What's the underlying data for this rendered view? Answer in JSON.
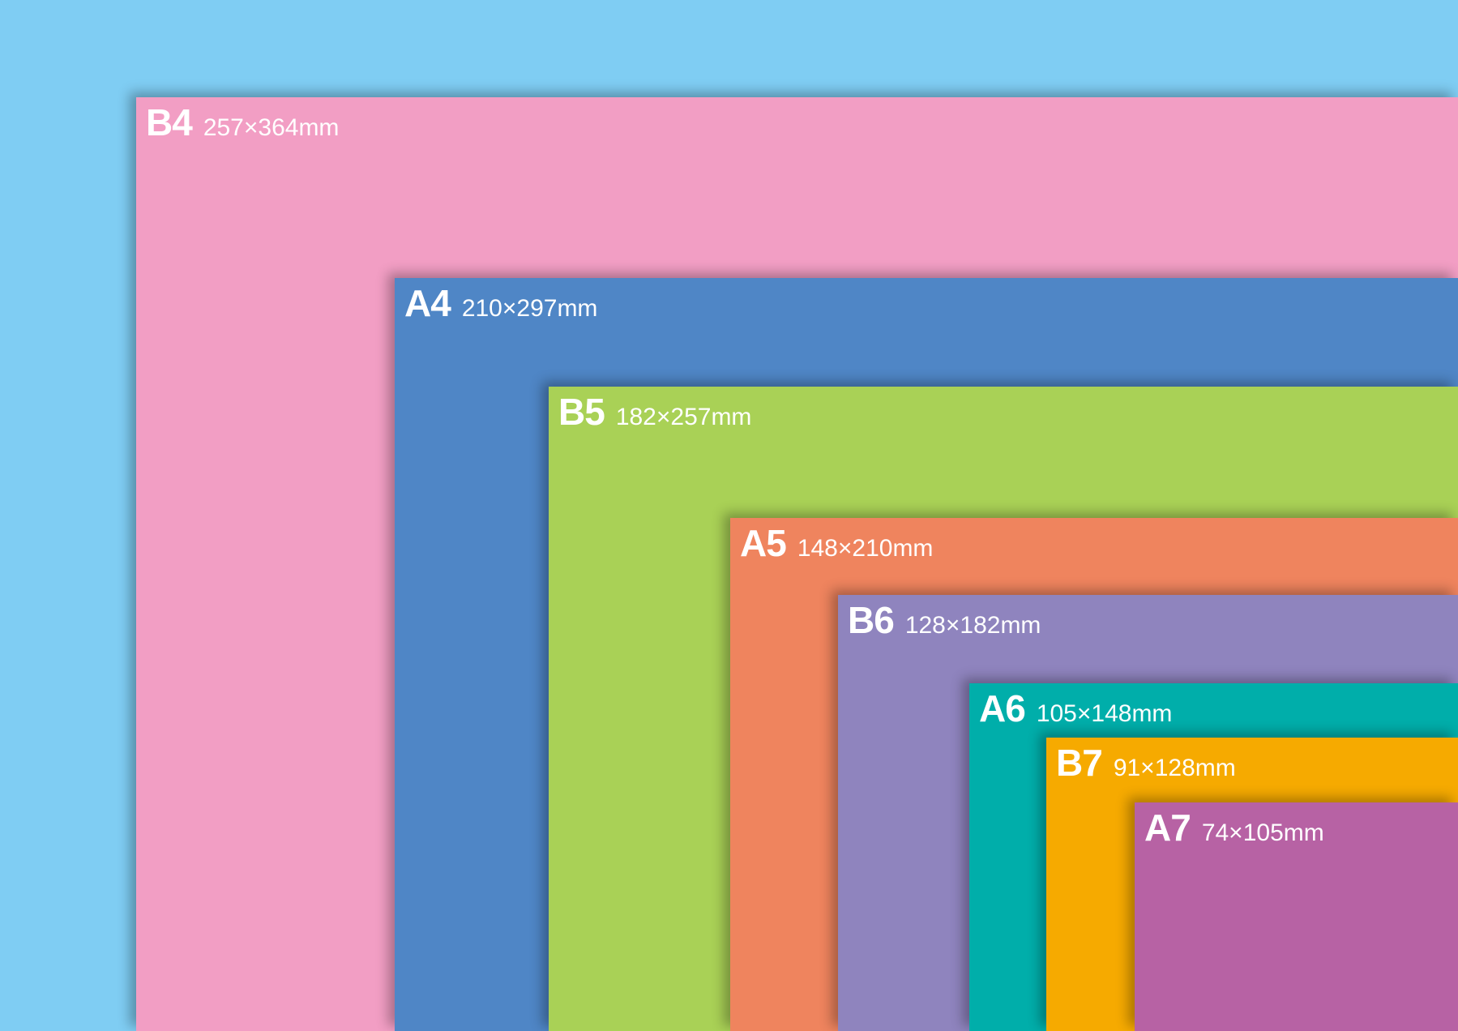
{
  "background_color": "#7fcdf3",
  "sheets": [
    {
      "name": "B4",
      "dimensions": "257×364mm",
      "color": "#f29ec4"
    },
    {
      "name": "A4",
      "dimensions": "210×297mm",
      "color": "#4f86c6"
    },
    {
      "name": "B5",
      "dimensions": "182×257mm",
      "color": "#a9d156"
    },
    {
      "name": "A5",
      "dimensions": "148×210mm",
      "color": "#ef845e"
    },
    {
      "name": "B6",
      "dimensions": "128×182mm",
      "color": "#8f84be"
    },
    {
      "name": "A6",
      "dimensions": "105×148mm",
      "color": "#00aeaa"
    },
    {
      "name": "B7",
      "dimensions": "91×128mm",
      "color": "#f6aa00"
    },
    {
      "name": "A7",
      "dimensions": "74×105mm",
      "color": "#b762a4"
    }
  ]
}
